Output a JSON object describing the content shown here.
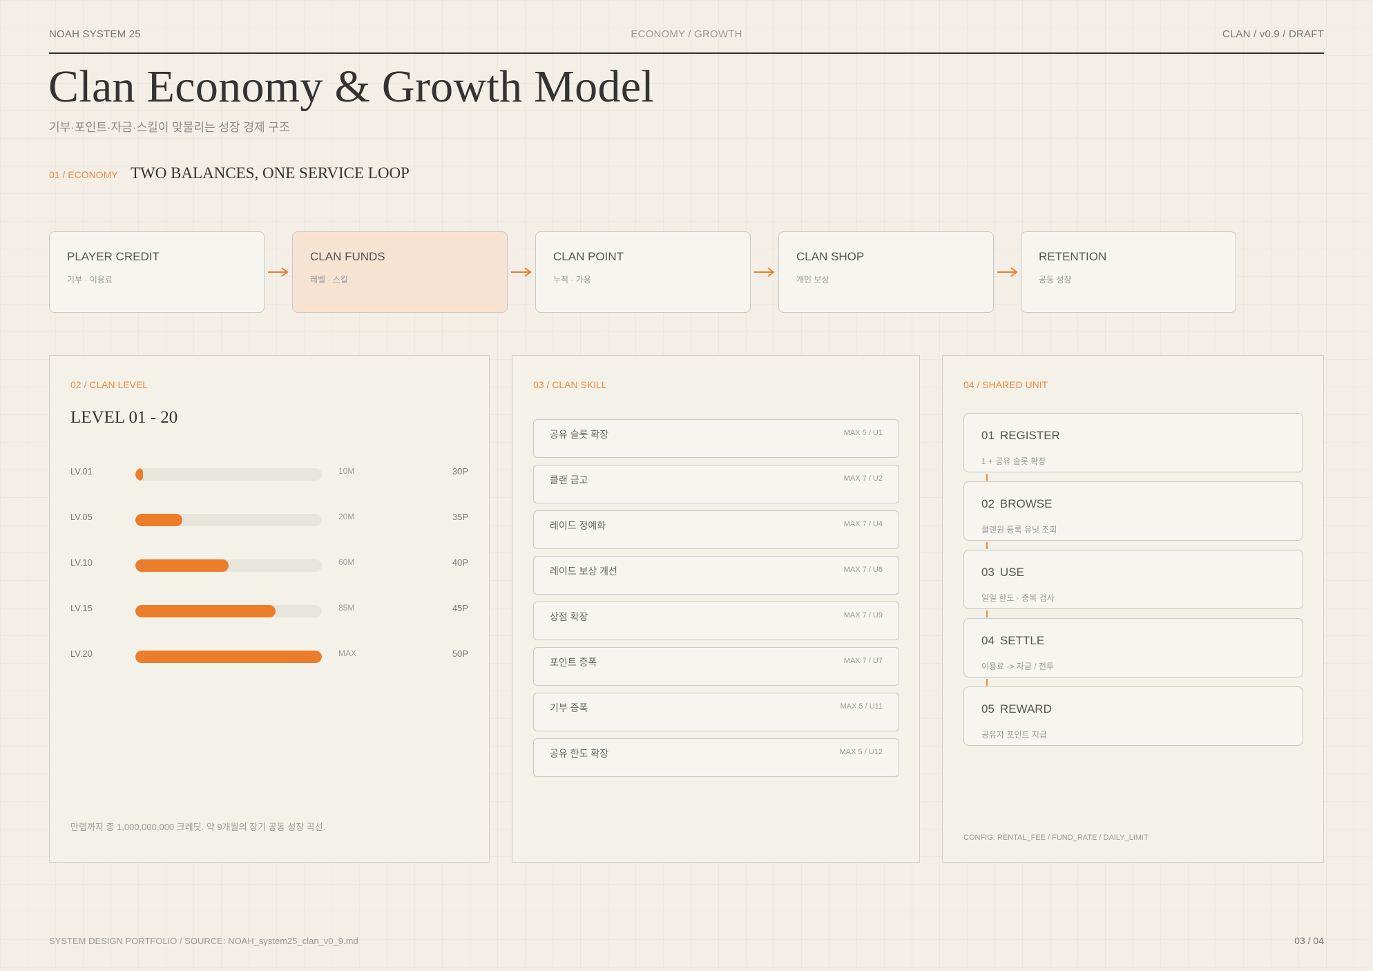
{
  "header": {
    "left": "NOAH SYSTEM 25",
    "center": "ECONOMY / GROWTH",
    "right": "CLAN / v0.9 / DRAFT"
  },
  "page": {
    "title": "Clan Economy & Growth Model",
    "subtitle": "기부·포인트·자금·스킬이 맞물리는 성장 경제 구조"
  },
  "economy": {
    "label": "01 / ECONOMY",
    "title": "TWO BALANCES, ONE SERVICE LOOP",
    "flow": [
      {
        "name": "PLAYER CREDIT",
        "sub": "기부 · 이용료",
        "highlight": false
      },
      {
        "name": "CLAN FUNDS",
        "sub": "레벨 · 스킬",
        "highlight": true
      },
      {
        "name": "CLAN POINT",
        "sub": "누적 · 가용",
        "highlight": false
      },
      {
        "name": "CLAN SHOP",
        "sub": "개인 보상",
        "highlight": false
      },
      {
        "name": "RETENTION",
        "sub": "공동 성장",
        "highlight": false
      }
    ],
    "accent_color": "#ee8a3c",
    "highlight_color": "#f7e3d2"
  },
  "clan_level": {
    "label": "02 / CLAN LEVEL",
    "title": "LEVEL 01 - 20",
    "rows": [
      {
        "level": "LV.01",
        "progress": 0.04,
        "requirement": "10M",
        "points": "30P"
      },
      {
        "level": "LV.05",
        "progress": 0.25,
        "requirement": "20M",
        "points": "35P"
      },
      {
        "level": "LV.10",
        "progress": 0.5,
        "requirement": "60M",
        "points": "40P"
      },
      {
        "level": "LV.15",
        "progress": 0.75,
        "requirement": "85M",
        "points": "45P"
      },
      {
        "level": "LV.20",
        "progress": 1.0,
        "requirement": "MAX",
        "points": "50P"
      }
    ],
    "note": "만렙까지 총 1,000,000,000 크레딧. 약 9개월의 장기 공동 성장 곡선.",
    "bar_color": "#ec7d2a"
  },
  "clan_skill": {
    "label": "03 / CLAN SKILL",
    "skills": [
      {
        "name": "공유 슬롯 확장",
        "max": "MAX 5 / U1"
      },
      {
        "name": "클랜 금고",
        "max": "MAX 7 / U2"
      },
      {
        "name": "레이드 정예화",
        "max": "MAX 7 / U4"
      },
      {
        "name": "레이드 보상 개선",
        "max": "MAX 7 / U6"
      },
      {
        "name": "상점 확장",
        "max": "MAX 7 / U9"
      },
      {
        "name": "포인트 증폭",
        "max": "MAX 7 / U7"
      },
      {
        "name": "기부 증폭",
        "max": "MAX 5 / U11"
      },
      {
        "name": "공유 한도 확장",
        "max": "MAX 5 / U12"
      }
    ]
  },
  "shared_unit": {
    "label": "04 / SHARED UNIT",
    "steps": [
      {
        "num": "01",
        "title": "REGISTER",
        "sub": "1 + 공유 슬롯 확장"
      },
      {
        "num": "02",
        "title": "BROWSE",
        "sub": "클랜원 등록 유닛 조회"
      },
      {
        "num": "03",
        "title": "USE",
        "sub": "일일 한도 · 중복 검사"
      },
      {
        "num": "04",
        "title": "SETTLE",
        "sub": "이용료 -> 자금 / 전투"
      },
      {
        "num": "05",
        "title": "REWARD",
        "sub": "공유자 포인트 지급"
      }
    ],
    "config": "CONFIG: RENTAL_FEE / FUND_RATE / DAILY_LIMIT"
  },
  "footer": {
    "left": "SYSTEM DESIGN PORTFOLIO / SOURCE: NOAH_system25_clan_v0_9.md",
    "right": "03 / 04"
  }
}
